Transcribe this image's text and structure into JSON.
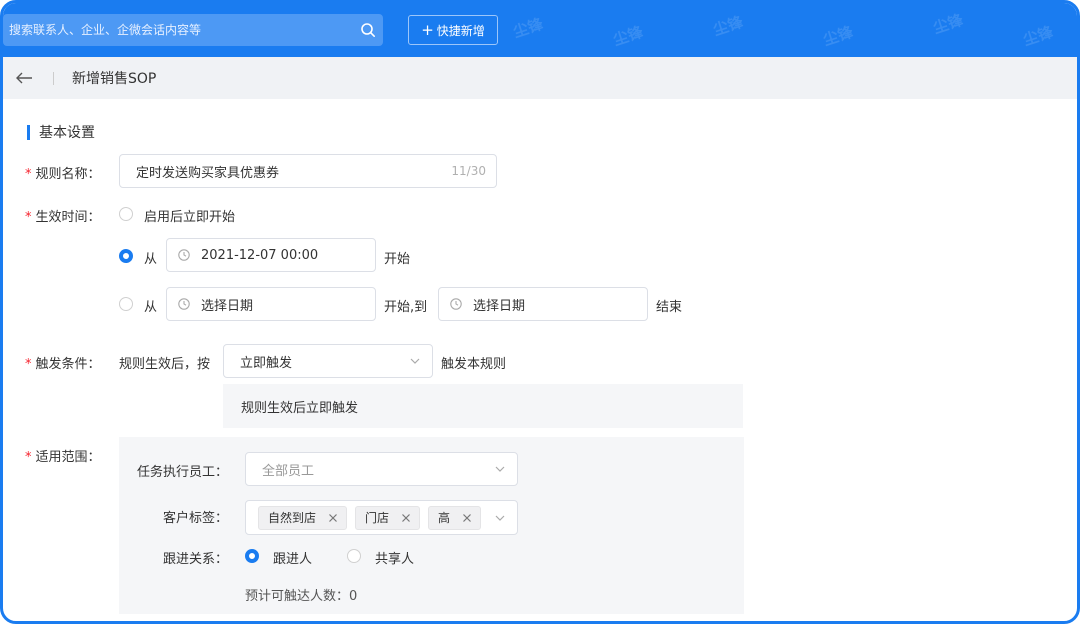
{
  "topbar": {
    "search_placeholder": "搜索联系人、企业、企微会话内容等",
    "quick_add_label": "快捷新增",
    "watermark": "尘锋"
  },
  "header": {
    "title": "新增销售SOP"
  },
  "section": {
    "basic_settings": "基本设置"
  },
  "form": {
    "required_mark": "*",
    "rule_name": {
      "label": "规则名称：",
      "value": "定时发送购买家具优惠券",
      "counter": "11/30"
    },
    "effective_time": {
      "label": "生效时间：",
      "option_immediate": "启用后立即开始",
      "from_label": "从",
      "start_value": "2021-12-07 00:00",
      "start_suffix": "开始",
      "date_placeholder": "选择日期",
      "mid_label": "开始,到",
      "end_suffix": "结束",
      "selected": "from"
    },
    "trigger": {
      "label": "触发条件：",
      "prefix": "规则生效后，按",
      "selected": "立即触发",
      "suffix": "触发本规则",
      "note": "规则生效后立即触发"
    },
    "scope": {
      "label": "适用范围：",
      "employees_label": "任务执行员工：",
      "employees_placeholder": "全部员工",
      "tags_label": "客户标签：",
      "tags": [
        "自然到店",
        "门店",
        "高"
      ],
      "relation_label": "跟进关系：",
      "relation_options": [
        "跟进人",
        "共享人"
      ],
      "relation_selected": "跟进人",
      "estimate": "预计可触达人数：0"
    }
  },
  "colors": {
    "brand": "#1a7cf0",
    "required": "#f5222d"
  }
}
